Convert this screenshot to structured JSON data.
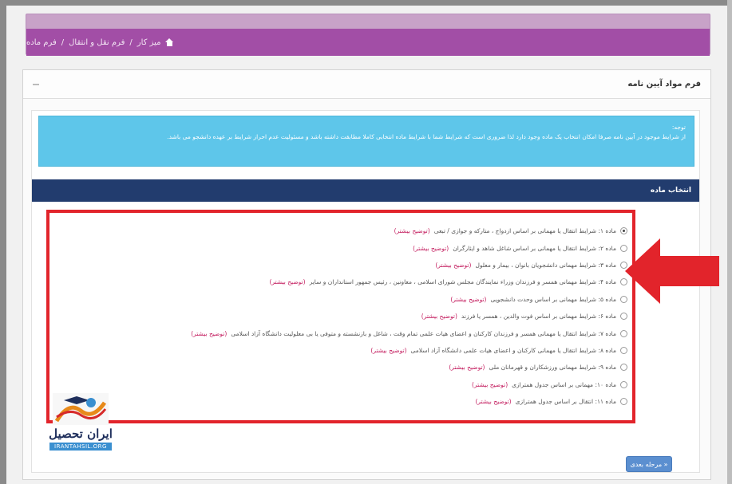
{
  "breadcrumb": {
    "items": [
      "میز کار",
      "فرم نقل و انتقال",
      "فرم ماده"
    ]
  },
  "panel": {
    "title": "فرم مواد آیین نامه"
  },
  "alert": {
    "heading": "توجه:",
    "text": "از شرایط موجود در آیین نامه صرفا امکان انتخاب یک ماده وجود دارد لذا ضروری است که شرایط شما با شرایط ماده انتخابی کاملا مطابقت داشته باشد و مسئولیت عدم احراز شرایط بر عهده دانشجو می باشد."
  },
  "section": {
    "title": "انتخاب ماده"
  },
  "options": [
    {
      "text": "ماده ۱: شرایط انتقال یا مهمانی بر اساس ازدواج ، متارکه و جوازی / تبعی",
      "link": "(توضیح بیشتر)",
      "checked": true
    },
    {
      "text": "ماده ۲: شرایط انتقال یا مهمانی بر اساس شاغل شاهد و ایثارگران",
      "link": "(توضیح بیشتر)",
      "checked": false
    },
    {
      "text": "ماده ۳: شرایط مهمانی دانشجویان بانوان ، بیمار و معلول",
      "link": "(توضیح بیشتر)",
      "checked": false
    },
    {
      "text": "ماده ۴: شرایط مهمانی همسر و فرزندان وزراء نمایندگان مجلس شورای اسلامی ، معاونین ، رئیس جمهور استانداران و سایر",
      "link": "(توضیح بیشتر)",
      "checked": false
    },
    {
      "text": "ماده ۵: شرایط مهمانی بر اساس وحدت دانشجویی",
      "link": "(توضیح بیشتر)",
      "checked": false
    },
    {
      "text": "ماده ۶: شرایط مهمانی بر اساس فوت والدین ، همسر یا فرزند",
      "link": "(توضیح بیشتر)",
      "checked": false
    },
    {
      "text": "ماده ۷: شرایط انتقال یا مهمانی همسر و فرزندان کارکنان و اعضای هیات علمی تمام وقت ، شاغل و بازنشسته و متوفی یا بی معلولیت دانشگاه آزاد اسلامی",
      "link": "(توضیح بیشتر)",
      "checked": false
    },
    {
      "text": "ماده ۸: شرایط انتقال یا مهمانی کارکنان و اعضای هیات علمی دانشگاه آزاد اسلامی",
      "link": "(توضیح بیشتر)",
      "checked": false
    },
    {
      "text": "ماده ۹: شرایط مهمانی ورزشکاران و قهرمانان ملی",
      "link": "(توضیح بیشتر)",
      "checked": false
    },
    {
      "text": "ماده ۱۰: مهمانی بر اساس جدول همترازی",
      "link": "(توضیح بیشتر)",
      "checked": false
    },
    {
      "text": "ماده ۱۱: انتقال بر اساس جدول همترازی",
      "link": "(توضیح بیشتر)",
      "checked": false
    }
  ],
  "next_button": {
    "label": "مرحله بعدی"
  },
  "watermark": {
    "brand": "ایران تحصیل",
    "domain": "IRANTAHSIL.ORG"
  },
  "colors": {
    "breadcrumb": "#a24ea6",
    "section_bar": "#223c6e",
    "alert": "#5ec6ea",
    "highlight": "#e2242b",
    "button": "#5b8fd0"
  }
}
